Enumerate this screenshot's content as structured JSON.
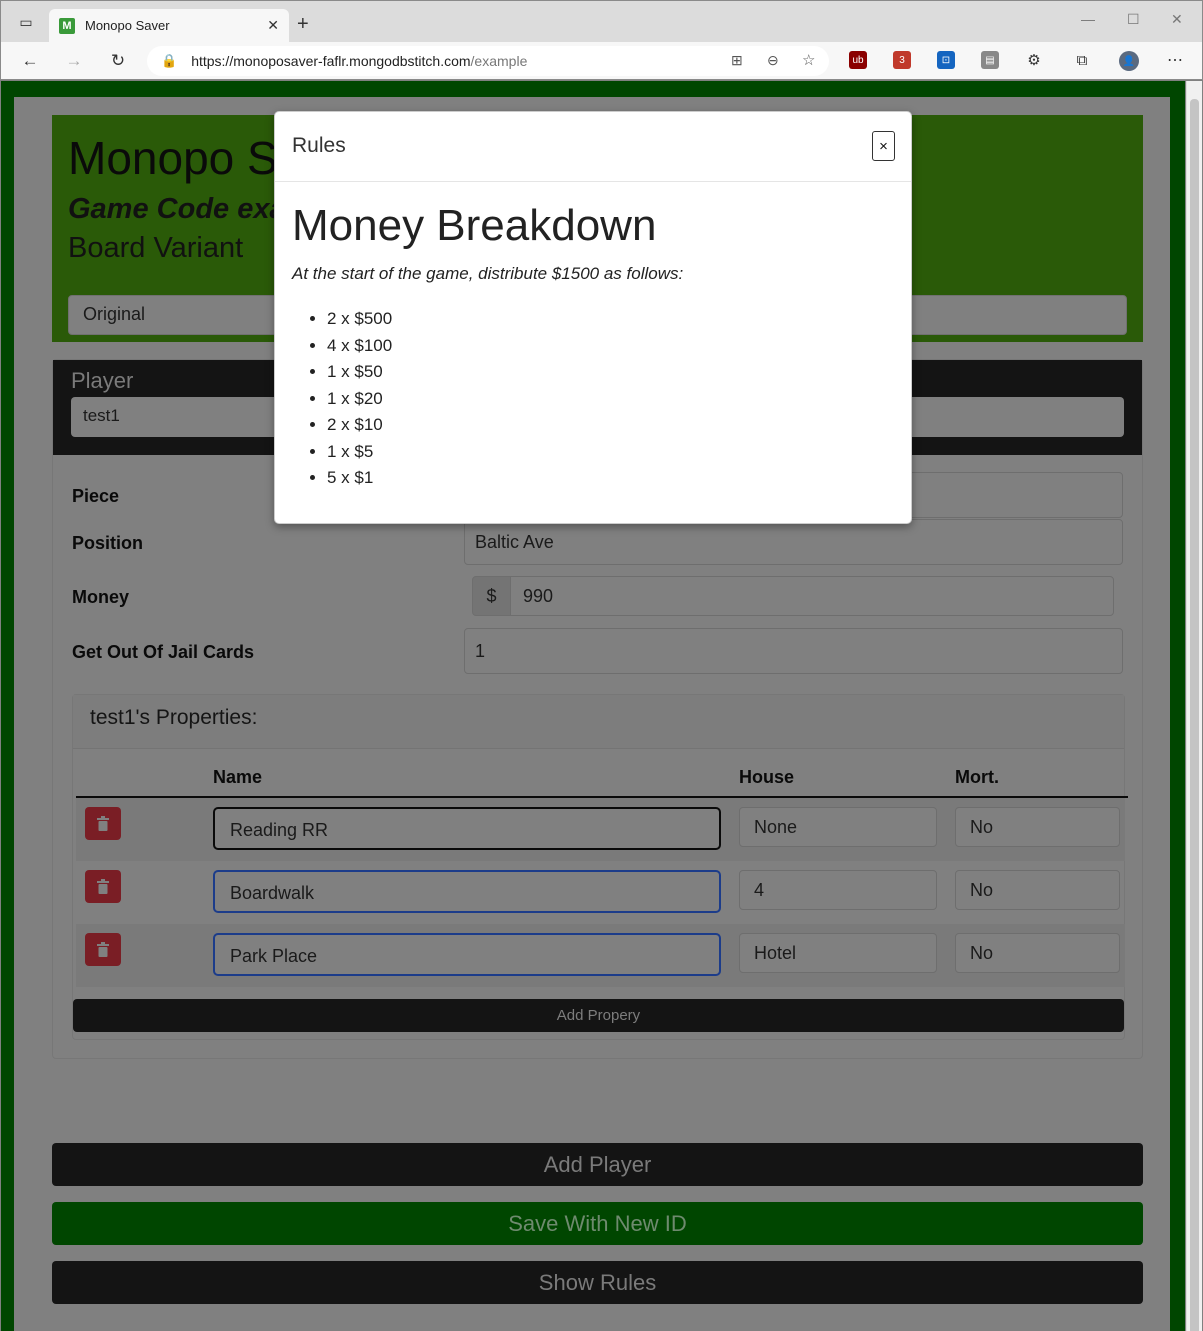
{
  "browser": {
    "tab_title": "Monopo Saver",
    "tab_favicon": "M",
    "url_host": "https://monoposaver-faflr.mongodbstitch.com",
    "url_path": "/example",
    "ext_badge": "3"
  },
  "hero": {
    "title": "Monopo Saver",
    "game_code": "Game Code example",
    "variant_label": "Board Variant",
    "variant_value": "Original"
  },
  "player": {
    "label": "Player",
    "name": "test1",
    "piece_label": "Piece",
    "position_label": "Position",
    "position_value": "Baltic Ave",
    "money_label": "Money",
    "money_addon": "$",
    "money_value": "990",
    "jail_label": "Get Out Of Jail Cards",
    "jail_value": "1"
  },
  "properties": {
    "heading": "test1's Properties:",
    "col_name": "Name",
    "col_house": "House",
    "col_mort": "Mort.",
    "rows": [
      {
        "name": "Reading RR",
        "house": "None",
        "mort": "No"
      },
      {
        "name": "Boardwalk",
        "house": "4",
        "mort": "No"
      },
      {
        "name": "Park Place",
        "house": "Hotel",
        "mort": "No"
      }
    ],
    "add_label": "Add Propery"
  },
  "actions": {
    "add_player": "Add Player",
    "save_new_id": "Save With New ID",
    "show_rules": "Show Rules"
  },
  "modal": {
    "title": "Rules",
    "close": "×",
    "heading": "Money Breakdown",
    "intro": "At the start of the game, distribute $1500 as follows:",
    "items": [
      "2 x $500",
      "4 x $100",
      "1 x $50",
      "1 x $20",
      "2 x $10",
      "1 x $5",
      "5 x $1"
    ]
  },
  "colors": {
    "page_bg": "#004600",
    "hero_bg": "#4ca80f",
    "danger": "#dc3545",
    "modal_bg": "#ffffff"
  }
}
